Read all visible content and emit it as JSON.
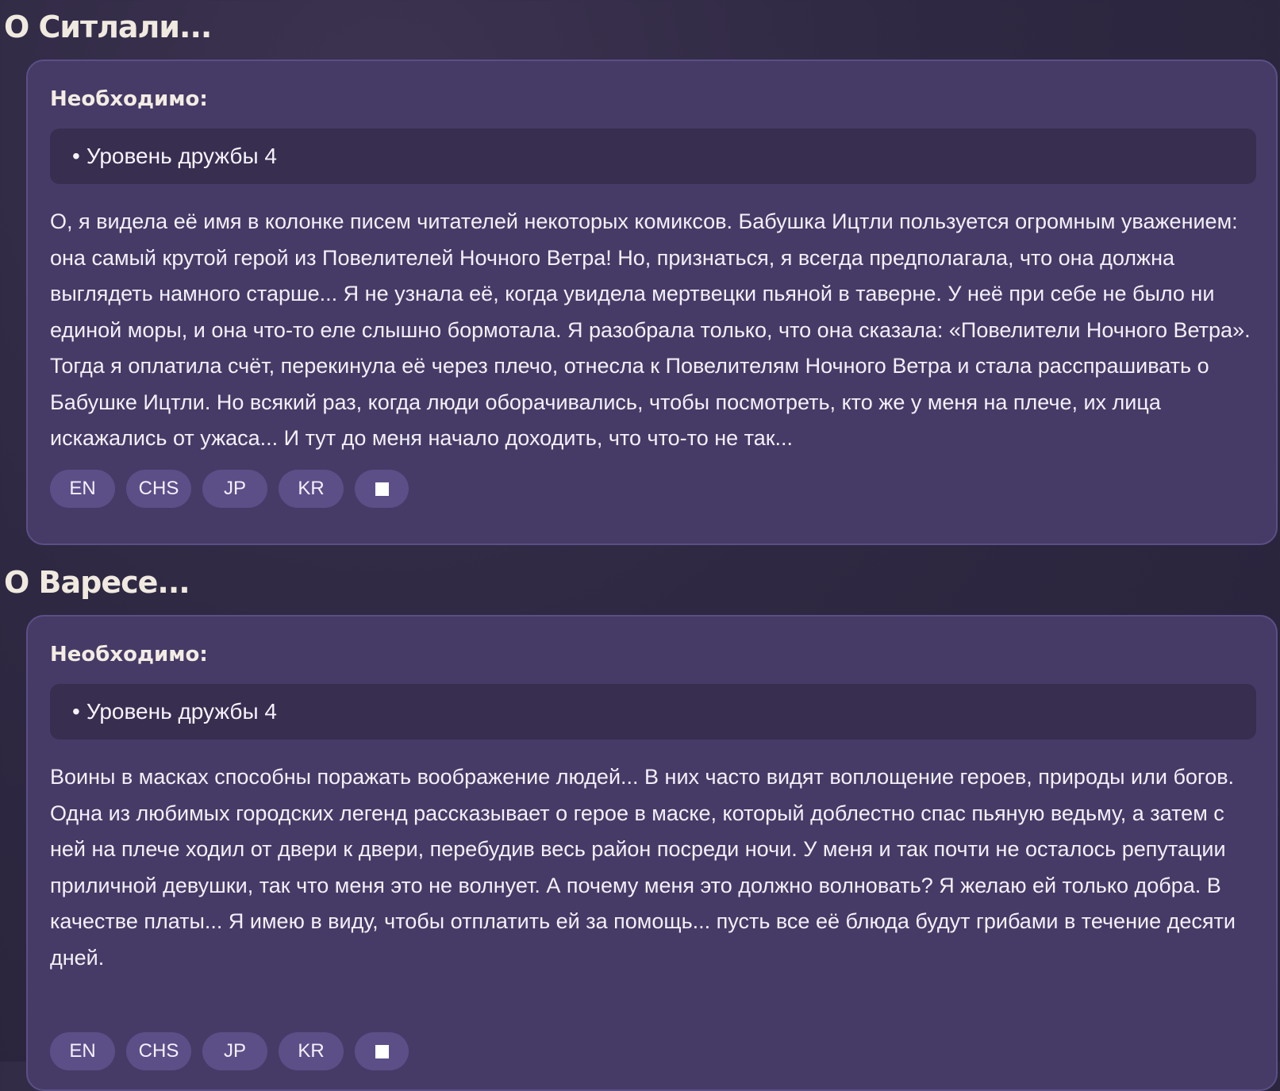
{
  "sections": [
    {
      "title": "О Ситлали...",
      "requirement_label": "Необходимо:",
      "requirements": [
        "Уровень дружбы 4"
      ],
      "text": "О, я видела её имя в колонке писем читателей некоторых комиксов. Бабушка Ицтли пользуется огромным уважением: она самый крутой герой из Повелителей Ночного Ветра! Но, признаться, я всегда предполагала, что она должна выглядеть намного старше... Я не узнала её, когда увидела мертвецки пьяной в таверне. У неё при себе не было ни единой моры, и она что-то еле слышно бормотала. Я разобрала только, что она сказала: «Повелители Ночного Ветра». Тогда я оплатила счёт, перекинула её через плечо, отнесла к Повелителям Ночного Ветра и стала расспрашивать о Бабушке Ицтли. Но всякий раз, когда люди оборачивались, чтобы посмотреть, кто же у меня на плече, их лица искажались от ужаса... И тут до меня начало доходить, что что-то не так...",
      "languages": [
        "EN",
        "CHS",
        "JP",
        "KR"
      ],
      "playback_icon": "stop-icon"
    },
    {
      "title": "О Варесе...",
      "requirement_label": "Необходимо:",
      "requirements": [
        "Уровень дружбы 4"
      ],
      "text": "Воины в масках способны поражать воображение людей... В них часто видят воплощение героев, природы или богов. Одна из любимых городских легенд рассказывает о герое в маске, который доблестно спас пьяную ведьму, а затем с ней на плече ходил от двери к двери, перебудив весь район посреди ночи. У меня и так почти не осталось репутации приличной девушки, так что меня это не волнует. А почему меня это должно волновать? Я желаю ей только добра. В качестве платы... Я имею в виду, чтобы отплатить ей за помощь... пусть все её блюда будут грибами в течение десяти дней.",
      "languages": [
        "EN",
        "CHS",
        "JP",
        "KR"
      ],
      "playback_icon": "stop-icon"
    }
  ],
  "colors": {
    "background": "#2e2842",
    "card": "#463b66",
    "card_border": "#5b4f86",
    "requirement_box": "#372e50",
    "language_button": "#5c4f88",
    "title_text": "#efe9e0"
  }
}
